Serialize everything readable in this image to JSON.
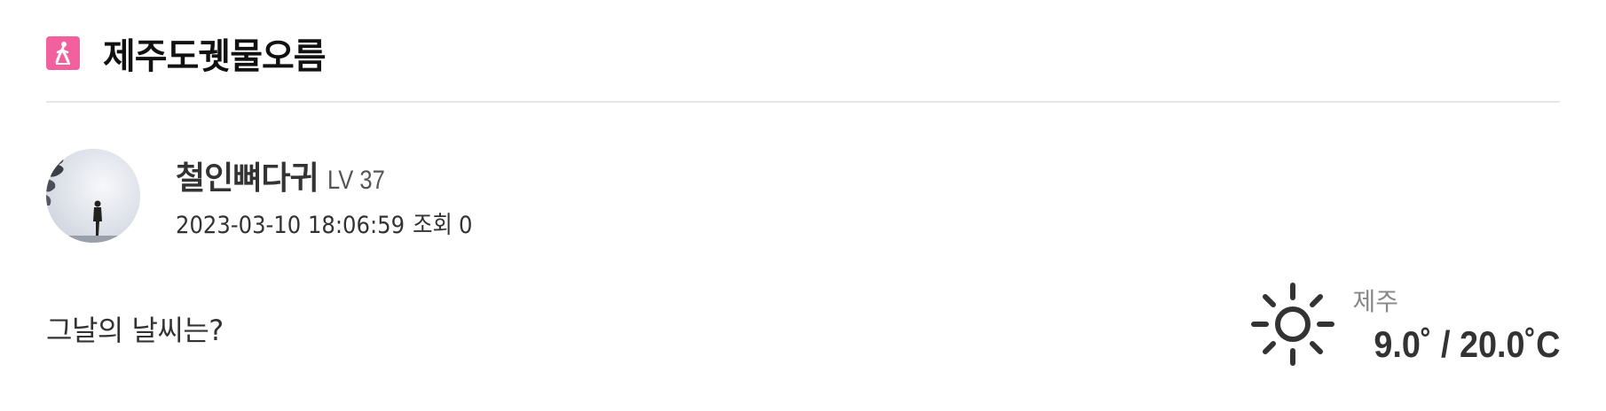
{
  "header": {
    "category_icon": "walking-person-icon",
    "title": "제주도궷물오름",
    "accent_color": "#f2609e"
  },
  "author": {
    "avatar": "avatar-silhouette-photo",
    "name": "철인뼈다귀",
    "level": "LV 37",
    "datetime": "2023-03-10 18:06:59",
    "views_label": "조회",
    "views_count": "0"
  },
  "weather": {
    "question": "그날의 날씨는?",
    "icon": "sun-icon",
    "location": "제주",
    "temperature": "9.0˚ / 20.0˚C"
  }
}
